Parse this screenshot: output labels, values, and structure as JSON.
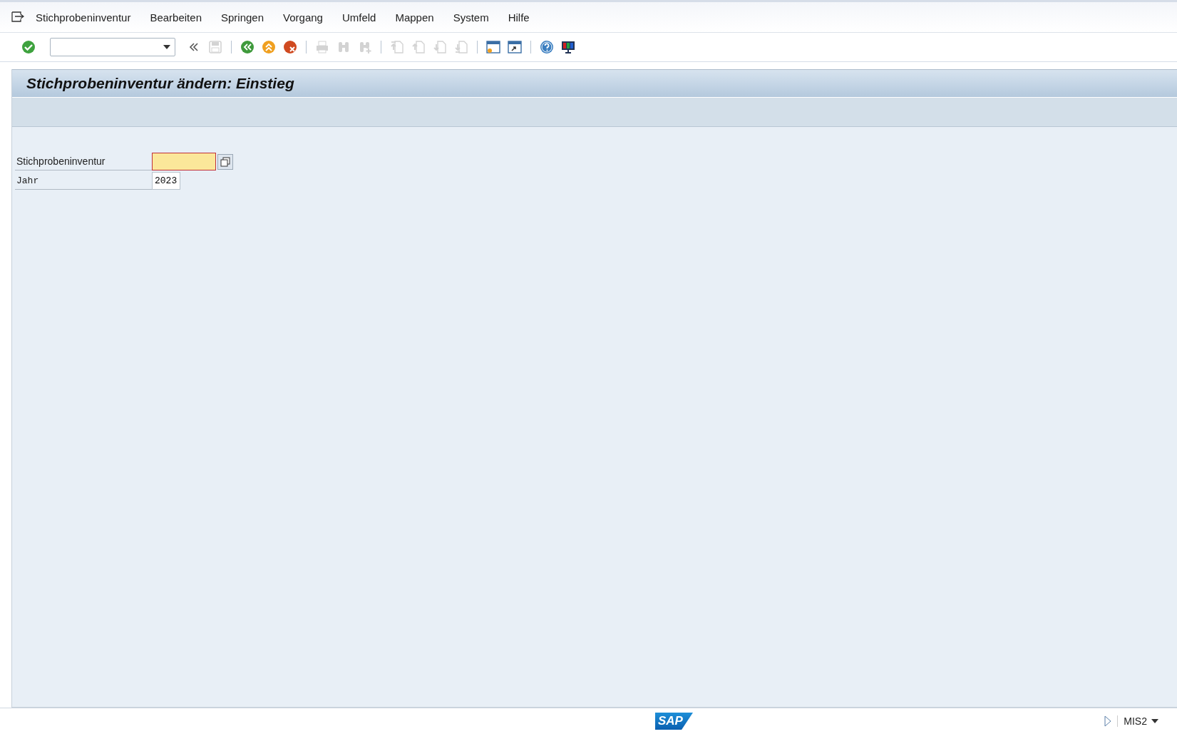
{
  "menu_bar": {
    "items": [
      "Stichprobeninventur",
      "Bearbeiten",
      "Springen",
      "Vorgang",
      "Umfeld",
      "Mappen",
      "System",
      "Hilfe"
    ]
  },
  "toolbar": {
    "buttons": [
      {
        "kind": "enter",
        "disabled": false
      },
      {
        "kind": "command"
      },
      {
        "kind": "collapse",
        "disabled": false
      },
      {
        "kind": "save",
        "disabled": true
      },
      {
        "kind": "sep"
      },
      {
        "kind": "back",
        "disabled": false
      },
      {
        "kind": "exit",
        "disabled": false
      },
      {
        "kind": "cancel",
        "disabled": false
      },
      {
        "kind": "sep"
      },
      {
        "kind": "print",
        "disabled": true
      },
      {
        "kind": "find",
        "disabled": true
      },
      {
        "kind": "find-next",
        "disabled": true
      },
      {
        "kind": "sep"
      },
      {
        "kind": "first-page",
        "disabled": true
      },
      {
        "kind": "prev-page",
        "disabled": true
      },
      {
        "kind": "next-page",
        "disabled": true
      },
      {
        "kind": "last-page",
        "disabled": true
      },
      {
        "kind": "sep"
      },
      {
        "kind": "new-session",
        "disabled": false
      },
      {
        "kind": "shortcut",
        "disabled": false
      },
      {
        "kind": "sep"
      },
      {
        "kind": "help",
        "disabled": false
      },
      {
        "kind": "layout",
        "disabled": false
      }
    ]
  },
  "title": "Stichprobeninventur ändern: Einstieg",
  "form": {
    "fields": [
      {
        "kind": "proportional",
        "label": "Stichprobeninventur",
        "required": true,
        "focused": true,
        "has_copy_button": true
      },
      {
        "kind": "mono",
        "label": "Jahr",
        "value": "2023",
        "required": false,
        "focused": false,
        "has_copy_button": false
      }
    ]
  },
  "status_bar": {
    "logo": "SAP",
    "system": "MIS2"
  }
}
